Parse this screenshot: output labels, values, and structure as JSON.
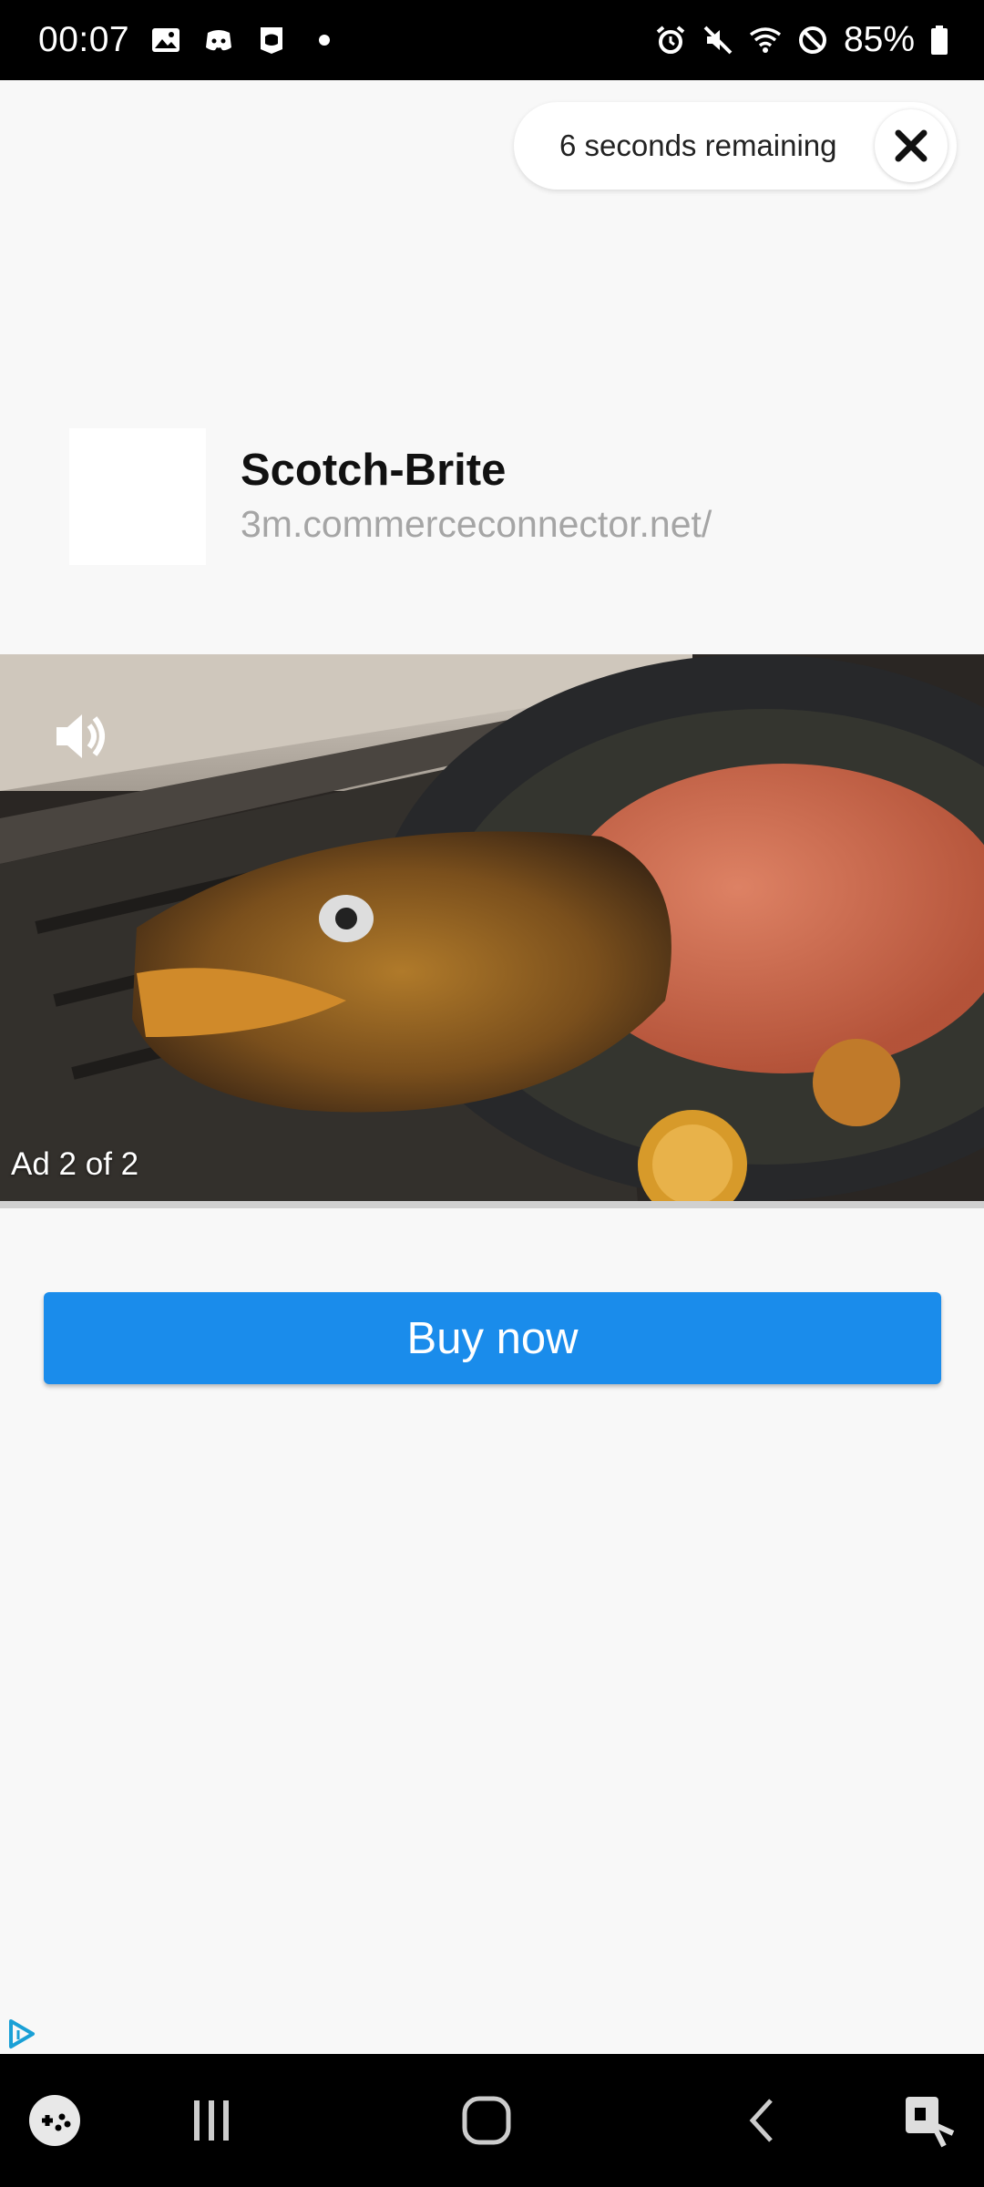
{
  "status_bar": {
    "time": "00:07",
    "battery_percent": "85%",
    "left_icons": [
      "gallery-icon",
      "discord-icon",
      "chat-app-icon",
      "notification-dot-icon"
    ],
    "right_icons": [
      "alarm-icon",
      "mute-icon",
      "wifi-icon",
      "do-not-disturb-icon",
      "battery-icon"
    ]
  },
  "skip": {
    "countdown_text": "6 seconds remaining",
    "close_icon": "close-icon"
  },
  "advertiser": {
    "name": "Scotch-Brite",
    "url": "3m.commerceconnector.net/"
  },
  "video": {
    "ad_counter": "Ad 2 of 2",
    "volume_icon": "volume-icon",
    "progress": 0.0
  },
  "cta": {
    "label": "Buy now",
    "color": "#1a8ceb"
  },
  "nav_bar": {
    "items": [
      "game-launcher-icon",
      "recents-icon",
      "home-icon",
      "back-icon",
      "accessibility-icon"
    ]
  },
  "colors": {
    "background": "#f8f8f8",
    "status_bar": "#000000",
    "accent": "#1a8ceb"
  }
}
